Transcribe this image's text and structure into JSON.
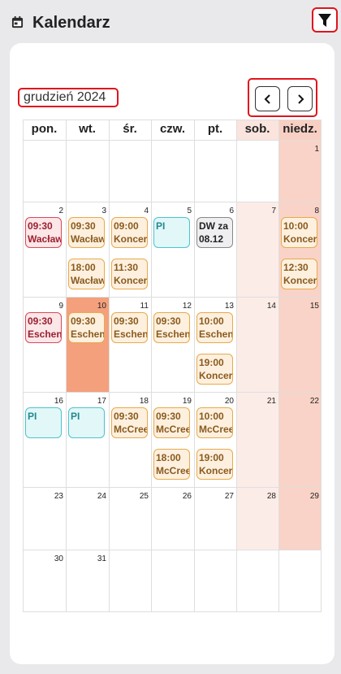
{
  "header": {
    "title": "Kalendarz"
  },
  "calendar": {
    "month_label": "grudzień 2024",
    "weekdays": [
      "pon.",
      "wt.",
      "śr.",
      "czw.",
      "pt.",
      "sob.",
      "niedz."
    ],
    "weeks": [
      [
        "",
        "",
        "",
        "",
        "",
        "",
        "1"
      ],
      [
        "2",
        "3",
        "4",
        "5",
        "6",
        "7",
        "8"
      ],
      [
        "9",
        "10",
        "11",
        "12",
        "13",
        "14",
        "15"
      ],
      [
        "16",
        "17",
        "18",
        "19",
        "20",
        "21",
        "22"
      ],
      [
        "23",
        "24",
        "25",
        "26",
        "27",
        "28",
        "29"
      ],
      [
        "30",
        "31",
        "",
        "",
        "",
        "",
        ""
      ]
    ],
    "today": "10",
    "events": [
      {
        "week": 1,
        "day": 0,
        "slot": 0,
        "line1": "09:30",
        "line2": "Wacław",
        "color": "red"
      },
      {
        "week": 1,
        "day": 1,
        "slot": 0,
        "line1": "09:30",
        "line2": "Wacław",
        "color": "orange"
      },
      {
        "week": 1,
        "day": 1,
        "slot": 1,
        "line1": "18:00",
        "line2": "Wacław",
        "color": "orange"
      },
      {
        "week": 1,
        "day": 2,
        "slot": 0,
        "line1": "09:00",
        "line2": "Koncert",
        "color": "orange"
      },
      {
        "week": 1,
        "day": 2,
        "slot": 1,
        "line1": "11:30",
        "line2": "Koncert",
        "color": "orange"
      },
      {
        "week": 1,
        "day": 3,
        "slot": 0,
        "line1": "PI",
        "line2": "",
        "color": "cyan"
      },
      {
        "week": 1,
        "day": 4,
        "slot": 0,
        "line1": "DW za",
        "line2": "08.12",
        "color": "gray"
      },
      {
        "week": 1,
        "day": 6,
        "slot": 0,
        "line1": "10:00",
        "line2": "Koncert",
        "color": "orange"
      },
      {
        "week": 1,
        "day": 6,
        "slot": 1,
        "line1": "12:30",
        "line2": "Koncert",
        "color": "orange"
      },
      {
        "week": 2,
        "day": 0,
        "slot": 0,
        "line1": "09:30",
        "line2": "Eschenbach",
        "color": "red"
      },
      {
        "week": 2,
        "day": 1,
        "slot": 0,
        "line1": "09:30",
        "line2": "Eschenbach",
        "color": "orange"
      },
      {
        "week": 2,
        "day": 2,
        "slot": 0,
        "line1": "09:30",
        "line2": "Eschenbach",
        "color": "orange"
      },
      {
        "week": 2,
        "day": 3,
        "slot": 0,
        "line1": "09:30",
        "line2": "Eschenbach",
        "color": "orange"
      },
      {
        "week": 2,
        "day": 4,
        "slot": 0,
        "line1": "10:00",
        "line2": "Eschenbach",
        "color": "orange"
      },
      {
        "week": 2,
        "day": 4,
        "slot": 1,
        "line1": "19:00",
        "line2": "Koncert",
        "color": "orange"
      },
      {
        "week": 3,
        "day": 0,
        "slot": 0,
        "line1": "PI",
        "line2": "",
        "color": "cyan"
      },
      {
        "week": 3,
        "day": 1,
        "slot": 0,
        "line1": "PI",
        "line2": "",
        "color": "cyan"
      },
      {
        "week": 3,
        "day": 2,
        "slot": 0,
        "line1": "09:30",
        "line2": "McCreesh",
        "color": "orange"
      },
      {
        "week": 3,
        "day": 3,
        "slot": 0,
        "line1": "09:30",
        "line2": "McCreesh",
        "color": "orange"
      },
      {
        "week": 3,
        "day": 3,
        "slot": 1,
        "line1": "18:00",
        "line2": "McCreesh",
        "color": "orange"
      },
      {
        "week": 3,
        "day": 4,
        "slot": 0,
        "line1": "10:00",
        "line2": "McCreesh",
        "color": "orange"
      },
      {
        "week": 3,
        "day": 4,
        "slot": 1,
        "line1": "19:00",
        "line2": "Koncert",
        "color": "orange"
      }
    ]
  },
  "colors": {
    "accent_outline": "#e0141c",
    "saturday_bg": "#fcece8",
    "sunday_bg": "#f9d3c7",
    "today_bg": "#f4a07c"
  }
}
